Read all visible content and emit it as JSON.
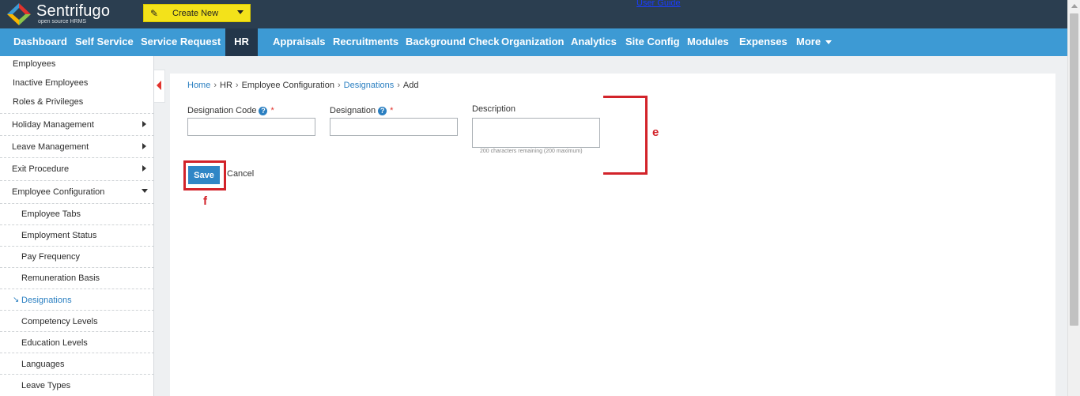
{
  "app": {
    "name": "Sentrifugo",
    "tagline": "open source HRMS",
    "create_new": "Create New",
    "user_guide": "User Guide"
  },
  "nav": {
    "items": [
      "Dashboard",
      "Self Service",
      "Service Request",
      "HR",
      "Appraisals",
      "Recruitments",
      "Background Check",
      "Organization",
      "Analytics",
      "Site Config",
      "Modules",
      "Expenses",
      "More"
    ],
    "active": "HR"
  },
  "sidebar": {
    "top_items": [
      "Employees",
      "Inactive Employees",
      "Roles & Privileges"
    ],
    "sections": [
      "Holiday Management",
      "Leave Management",
      "Exit Procedure",
      "Employee Configuration"
    ],
    "sub_items": [
      "Employee Tabs",
      "Employment Status",
      "Pay Frequency",
      "Remuneration Basis",
      "Designations",
      "Competency Levels",
      "Education Levels",
      "Languages",
      "Leave Types"
    ],
    "active_sub": "Designations",
    "active_marker": "↘"
  },
  "breadcrumb": {
    "items": [
      "Home",
      "HR",
      "Employee Configuration",
      "Designations",
      "Add"
    ],
    "separator": "›"
  },
  "form": {
    "code_label": "Designation Code",
    "designation_label": "Designation",
    "description_label": "Description",
    "required_mark": "*",
    "help_mark": "?",
    "code_value": "",
    "designation_value": "",
    "description_value": "",
    "chars_remaining": "200 characters remaining (200 maximum)",
    "save_label": "Save",
    "cancel_label": "Cancel"
  },
  "annotations": {
    "e": "e",
    "f": "f"
  },
  "colors": {
    "topbar": "#2b3e50",
    "nav": "#3d9ad4",
    "nav_active": "#23364a",
    "create_new": "#f3e21a",
    "link": "#2a7fc1",
    "annotation": "#d2232a"
  }
}
